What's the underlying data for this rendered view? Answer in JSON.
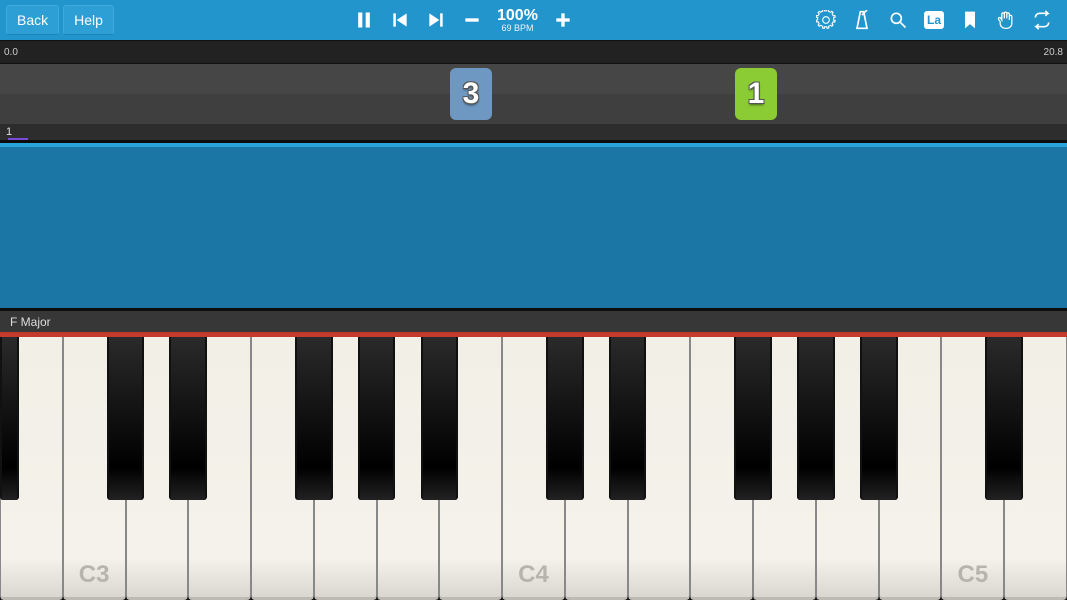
{
  "toolbar": {
    "back": "Back",
    "help": "Help",
    "tempo_percent": "100%",
    "tempo_bpm": "69 BPM",
    "la_label": "La"
  },
  "timeline": {
    "start": "0.0",
    "end": "20.8",
    "track_number": "1",
    "finger_left": "3",
    "finger_right": "1"
  },
  "scale": {
    "name": "F Major"
  },
  "keyboard": {
    "white_keys": 17,
    "first_white_is_B": true,
    "labels": {
      "1": "C3",
      "8": "C4",
      "15": "C5"
    }
  }
}
